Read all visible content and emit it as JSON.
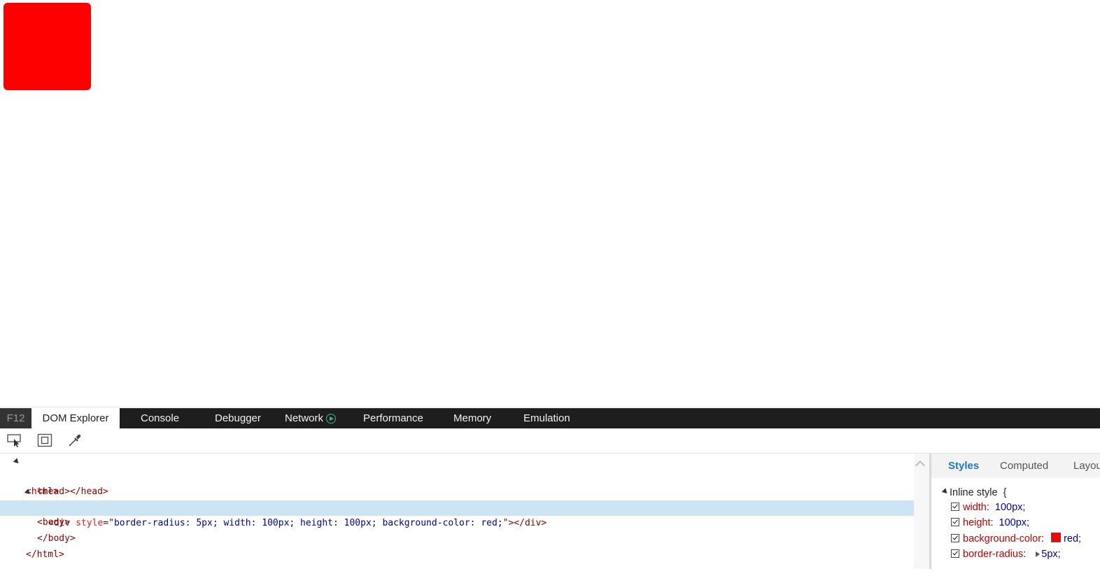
{
  "page": {
    "box_color": "#ff0000"
  },
  "devtools": {
    "tabs": {
      "f12": "F12",
      "dom_explorer": "DOM Explorer",
      "console": "Console",
      "debugger": "Debugger",
      "network": "Network",
      "performance": "Performance",
      "memory": "Memory",
      "emulation": "Emulation"
    },
    "toolbar": {
      "select_icon": "select-element-icon",
      "highlight_icon": "highlight-box-icon",
      "color_picker_icon": "eyedropper-icon"
    },
    "tree": {
      "html_open": "<html>",
      "head": "<head></head>",
      "body_open": "<body>",
      "div_open": "<div ",
      "div_attr_name": "style",
      "div_eq": "=\"",
      "div_attr_value": "border-radius: 5px; width: 100px; height: 100px; background-color: red;",
      "div_close": "\"></div>",
      "body_close": "</body>",
      "html_close": "</html>"
    },
    "styles_pane": {
      "tabs": {
        "styles": "Styles",
        "computed": "Computed",
        "layout": "Layout"
      },
      "rule_header": "Inline style",
      "rule_brace": "{",
      "properties": [
        {
          "name": "width",
          "value": "100px;"
        },
        {
          "name": "height",
          "value": "100px;"
        },
        {
          "name": "background-color",
          "value": "red;",
          "swatch": "#ff0000"
        },
        {
          "name": "border-radius",
          "value": "5px;"
        }
      ]
    }
  }
}
